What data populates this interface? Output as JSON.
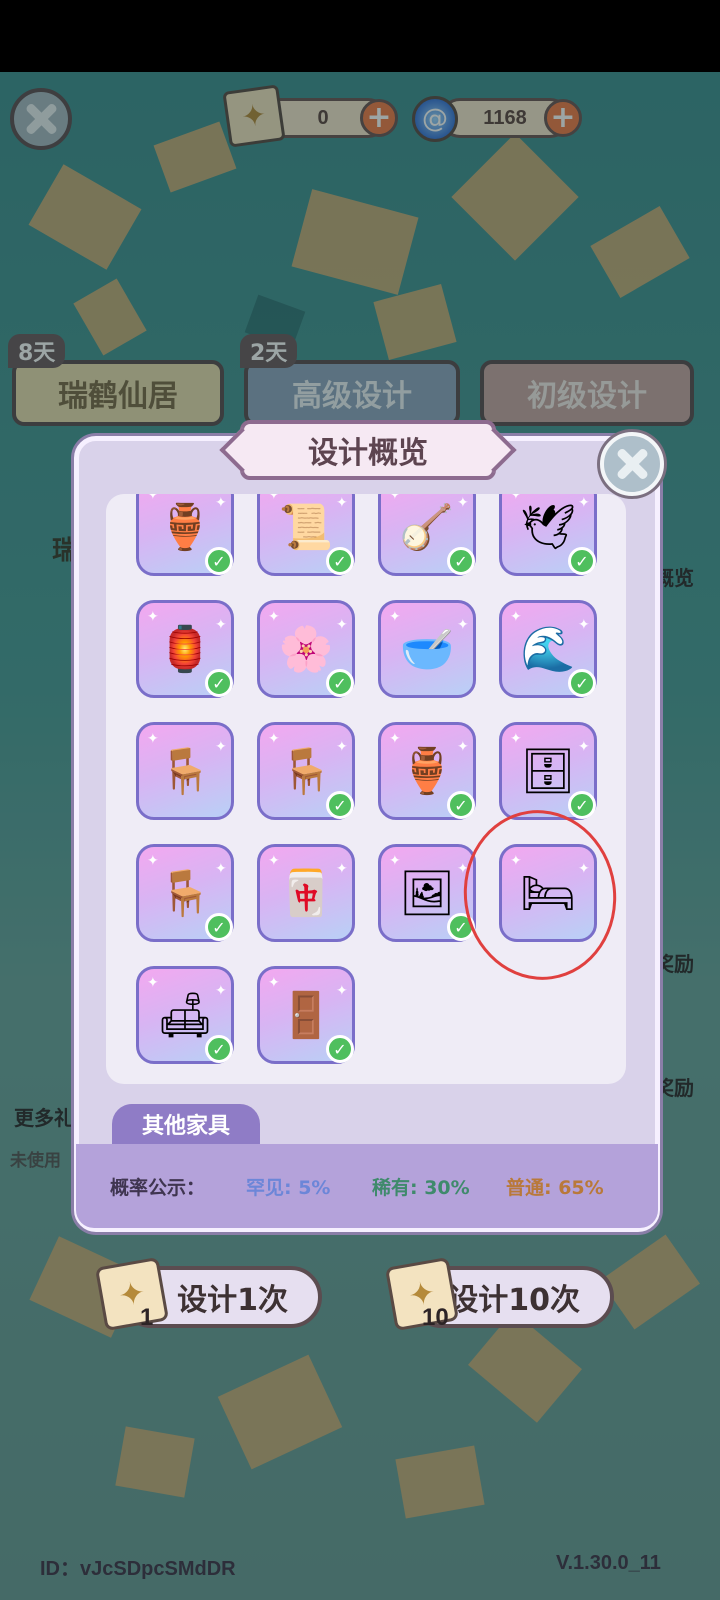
{
  "currency": {
    "scrolls": "0",
    "gems": "1168"
  },
  "tabs": [
    {
      "label": "瑞鹤仙居",
      "badge": "8天"
    },
    {
      "label": "高级设计",
      "badge": "2天"
    },
    {
      "label": "初级设计"
    }
  ],
  "background_fragments": {
    "tab_text_fragment": "瑞",
    "overview_fragment": "概览",
    "reward_1": "奖励",
    "reward_2": "奖励",
    "more_fragment": "更多礼",
    "unused_fragment": "未使用"
  },
  "modal": {
    "title": "设计概览",
    "items": [
      {
        "icon": "incense-burner-icon",
        "glyph": "🏺",
        "owned": true
      },
      {
        "icon": "scroll-painting-icon",
        "glyph": "📜",
        "owned": true
      },
      {
        "icon": "pipa-instrument-icon",
        "glyph": "🪕",
        "owned": true
      },
      {
        "icon": "crane-statue-icon",
        "glyph": "🕊",
        "owned": true
      },
      {
        "icon": "lantern-stand-icon",
        "glyph": "🏮",
        "owned": true
      },
      {
        "icon": "plum-blossom-vase-icon",
        "glyph": "🌸",
        "owned": true
      },
      {
        "icon": "treasure-bowl-icon",
        "glyph": "🥣",
        "owned": false
      },
      {
        "icon": "wave-tray-icon",
        "glyph": "🌊",
        "owned": true
      },
      {
        "icon": "square-stool-icon",
        "glyph": "🪑",
        "owned": false
      },
      {
        "icon": "tall-stand-icon",
        "glyph": "🪑",
        "owned": true
      },
      {
        "icon": "gourd-vase-icon",
        "glyph": "🏺",
        "owned": true
      },
      {
        "icon": "display-shelf-icon",
        "glyph": "🗄",
        "owned": true
      },
      {
        "icon": "armchair-icon",
        "glyph": "🪑",
        "owned": true
      },
      {
        "icon": "folding-screen-icon",
        "glyph": "🀄",
        "owned": false
      },
      {
        "icon": "painted-screen-icon",
        "glyph": "🖼",
        "owned": true
      },
      {
        "icon": "canopy-bed-icon",
        "glyph": "🛏",
        "owned": false
      },
      {
        "icon": "low-bench-icon",
        "glyph": "🛋",
        "owned": true
      },
      {
        "icon": "lattice-screen-icon",
        "glyph": "🚪",
        "owned": true
      }
    ],
    "section_label": "其他家具",
    "probability": {
      "label": "概率公示：",
      "rare": "罕见: 5%",
      "uncommon": "稀有: 30%",
      "common": "普通: 65%"
    },
    "colors": {
      "rare": "#6c86d8",
      "uncommon": "#3f8a6c",
      "common": "#b9793a"
    }
  },
  "actions": [
    {
      "label": "设计1次",
      "count": "1"
    },
    {
      "label": "设计10次",
      "count": "10"
    }
  ],
  "footer": {
    "id": "ID：vJcSDpcSMdDR",
    "version": "V.1.30.0_11"
  }
}
